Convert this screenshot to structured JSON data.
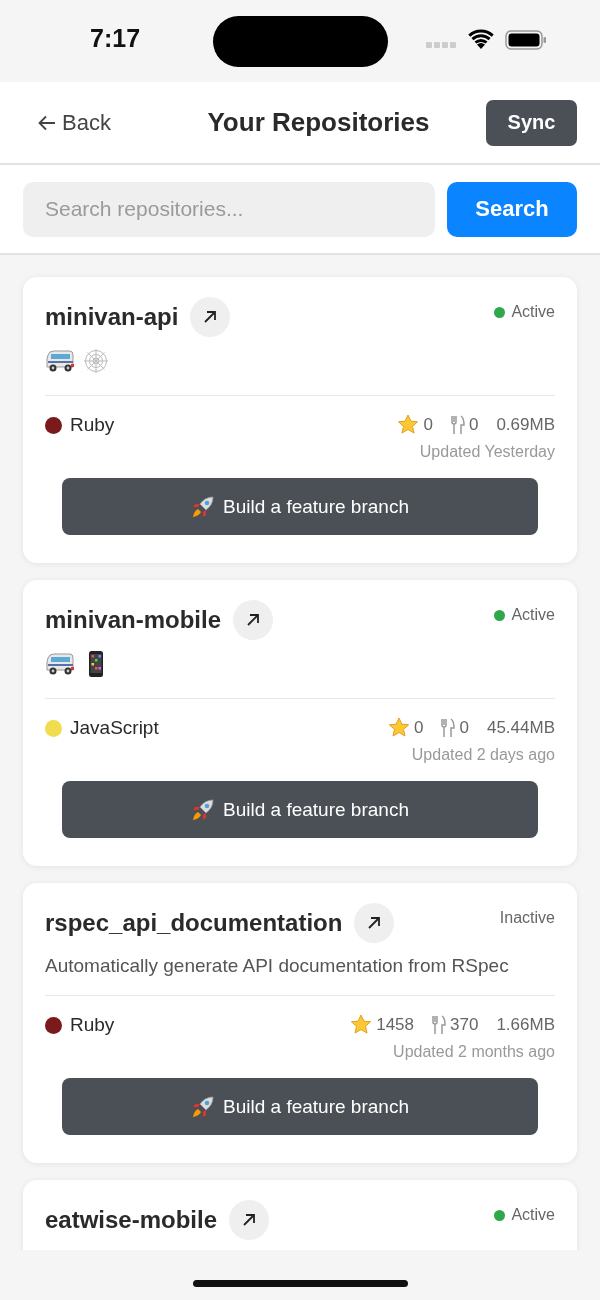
{
  "status_bar": {
    "time": "7:17"
  },
  "header": {
    "back": "Back",
    "title": "Your Repositories",
    "sync": "Sync"
  },
  "search": {
    "placeholder": "Search repositories...",
    "button": "Search"
  },
  "repositories": [
    {
      "name": "minivan-api",
      "active": true,
      "status": "Active",
      "topics": [
        {
          "kind": "van"
        },
        {
          "kind": "web"
        }
      ],
      "language": "Ruby",
      "color": "#7b1a1a",
      "star_count": "0",
      "fork_count": "0",
      "size": "0.69MB",
      "updated": "Updated Yesterday",
      "action": "Build a feature branch"
    },
    {
      "name": "minivan-mobile",
      "active": true,
      "status": "Active",
      "topics": [
        {
          "kind": "van"
        },
        {
          "kind": "phone"
        }
      ],
      "language": "JavaScript",
      "color": "#f0dc4e",
      "star_count": "0",
      "fork_count": "0",
      "size": "45.44MB",
      "updated": "Updated 2 days ago",
      "action": "Build a feature branch"
    },
    {
      "name": "rspec_api_documentation",
      "active": false,
      "status": "Inactive",
      "description": "Automatically generate API documentation from RSpec",
      "language": "Ruby",
      "color": "#7b1a1a",
      "star_count": "1458",
      "fork_count": "370",
      "size": "1.66MB",
      "updated": "Updated 2 months ago",
      "action": "Build a feature branch"
    },
    {
      "name": "eatwise-mobile",
      "active": true,
      "status": "Active"
    }
  ]
}
